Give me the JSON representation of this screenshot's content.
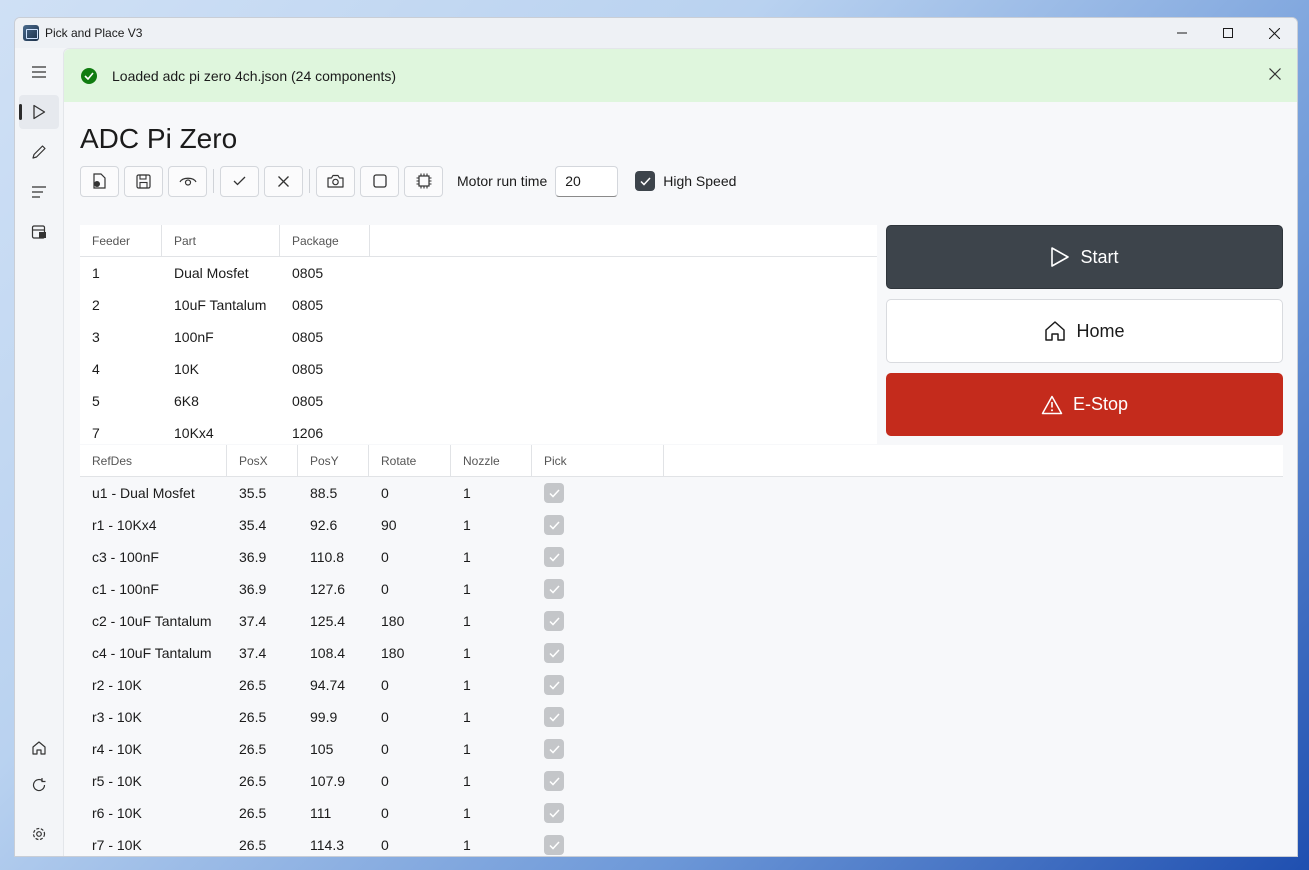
{
  "window": {
    "title": "Pick and Place V3"
  },
  "infobar": {
    "message": "Loaded adc pi zero 4ch.json (24 components)"
  },
  "page": {
    "title": "ADC Pi Zero"
  },
  "toolbar": {
    "motor_label": "Motor run time",
    "motor_value": "20",
    "high_speed_label": "High Speed",
    "high_speed_checked": true
  },
  "feeders": {
    "columns": [
      "Feeder",
      "Part",
      "Package"
    ],
    "rows": [
      [
        "1",
        "Dual Mosfet",
        "0805"
      ],
      [
        "2",
        "10uF Tantalum",
        "0805"
      ],
      [
        "3",
        "100nF",
        "0805"
      ],
      [
        "4",
        "10K",
        "0805"
      ],
      [
        "5",
        "6K8",
        "0805"
      ],
      [
        "7",
        "10Kx4",
        "1206"
      ]
    ]
  },
  "actions": {
    "start": "Start",
    "home": "Home",
    "estop": "E-Stop"
  },
  "components": {
    "columns": [
      "RefDes",
      "PosX",
      "PosY",
      "Rotate",
      "Nozzle",
      "Pick"
    ],
    "rows": [
      [
        "u1 - Dual Mosfet",
        "35.5",
        "88.5",
        "0",
        "1",
        true
      ],
      [
        "r1 - 10Kx4",
        "35.4",
        "92.6",
        "90",
        "1",
        true
      ],
      [
        "c3 - 100nF",
        "36.9",
        "110.8",
        "0",
        "1",
        true
      ],
      [
        "c1 - 100nF",
        "36.9",
        "127.6",
        "0",
        "1",
        true
      ],
      [
        "c2 - 10uF Tantalum",
        "37.4",
        "125.4",
        "180",
        "1",
        true
      ],
      [
        "c4 - 10uF Tantalum",
        "37.4",
        "108.4",
        "180",
        "1",
        true
      ],
      [
        "r2 - 10K",
        "26.5",
        "94.74",
        "0",
        "1",
        true
      ],
      [
        "r3 - 10K",
        "26.5",
        "99.9",
        "0",
        "1",
        true
      ],
      [
        "r4 - 10K",
        "26.5",
        "105",
        "0",
        "1",
        true
      ],
      [
        "r5 - 10K",
        "26.5",
        "107.9",
        "0",
        "1",
        true
      ],
      [
        "r6 - 10K",
        "26.5",
        "111",
        "0",
        "1",
        true
      ],
      [
        "r7 - 10K",
        "26.5",
        "114.3",
        "0",
        "1",
        true
      ]
    ]
  },
  "icons": {
    "sidebar": [
      "menu-icon",
      "play-icon",
      "pencil-icon",
      "list-icon",
      "chip-tray-icon",
      "home-icon",
      "refresh-icon",
      "settings-icon"
    ],
    "toolbar": [
      "open-file-icon",
      "save-icon",
      "eye-icon",
      "check-icon",
      "close-icon",
      "camera-icon",
      "square-icon",
      "chip-icon"
    ]
  },
  "colors": {
    "start": "#3d444b",
    "estop": "#c42b1c",
    "success_bar": "#dff6dd",
    "success_icon": "#107c10"
  }
}
